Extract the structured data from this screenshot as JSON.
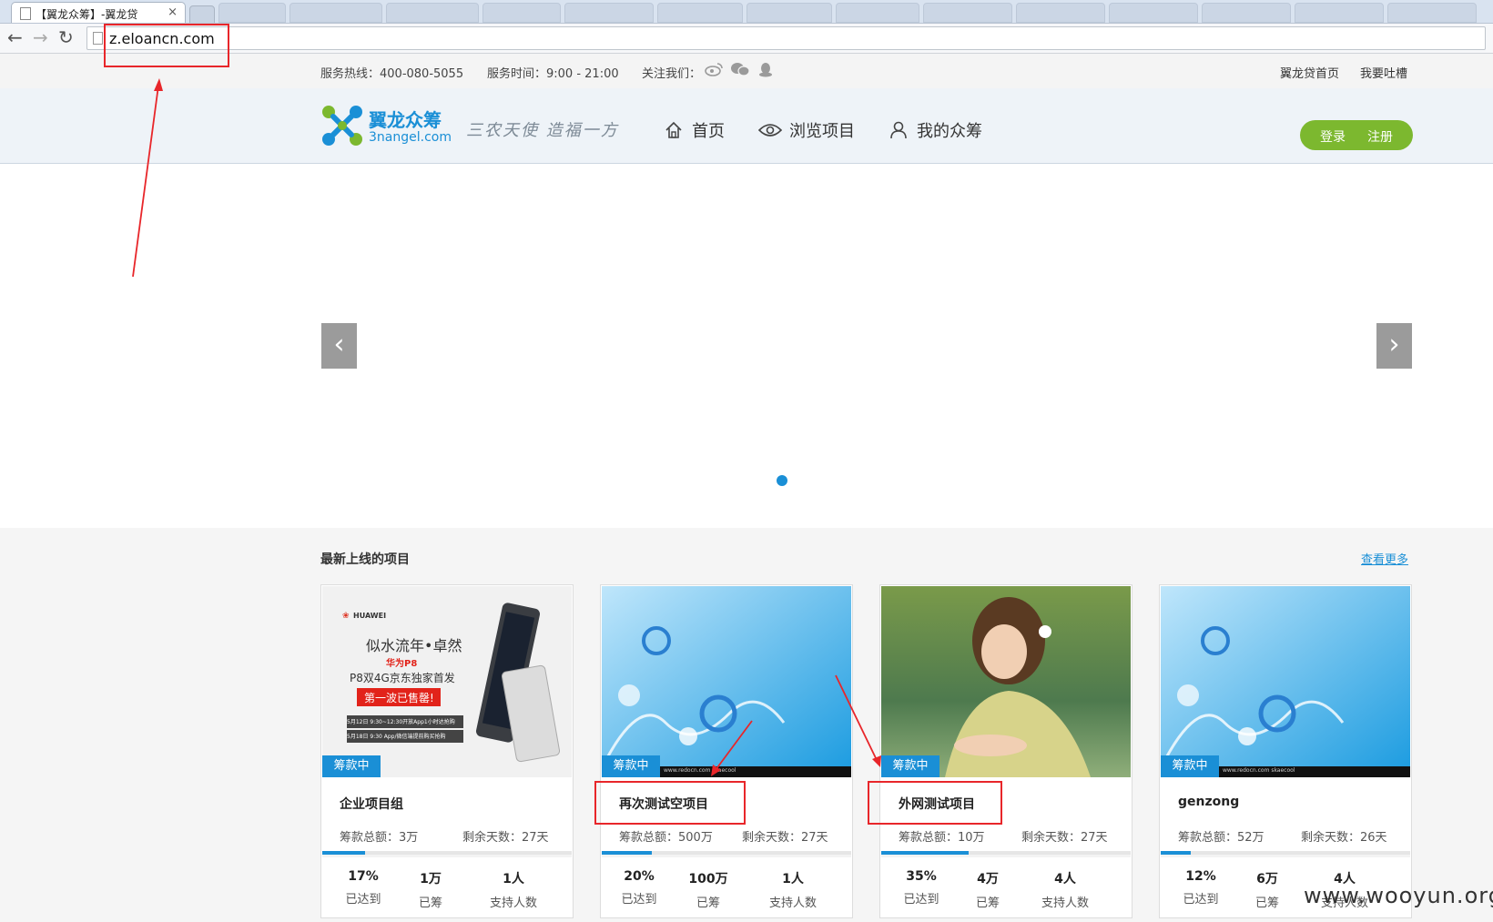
{
  "browser": {
    "tab_title": "【翼龙众筹】-翼龙贷",
    "tab_close": "×",
    "url": "z.eloancn.com"
  },
  "topbar": {
    "hotline": "服务热线：400-080-5055",
    "hours": "服务时间：9:00 - 21:00",
    "follow": "关注我们：",
    "home_link": "翼龙贷首页",
    "feedback_link": "我要吐槽"
  },
  "header": {
    "logo_cn": "翼龙众筹",
    "logo_en": "3nangel.com",
    "slogan": "三农天使  造福一方",
    "nav": [
      {
        "label": "首页",
        "icon": "home-icon"
      },
      {
        "label": "浏览项目",
        "icon": "eye-icon"
      },
      {
        "label": "我的众筹",
        "icon": "user-icon"
      }
    ],
    "login": "登录",
    "register": "注册"
  },
  "banner": {
    "prev": "‹",
    "next": "›"
  },
  "section": {
    "title": "最新上线的项目",
    "more": "查看更多",
    "projects": [
      {
        "name": "企业项目组",
        "badge": "筹款中",
        "total": "筹款总额：3万",
        "remain": "剩余天数：27天",
        "progress": 17,
        "percent": "17%",
        "percent_label": "已达到",
        "raised": "1万",
        "raised_label": "已筹",
        "backers": "1人",
        "backers_label": "支持人数",
        "image": "huawei-ad",
        "ad": {
          "brand": "HUAWEI",
          "title": "似水流年•卓然",
          "model": "华为P8",
          "sub": "P8双4G京东独家首发",
          "sold": "第一波已售罄!",
          "line1_tag": "5月12日",
          "line1": "9:30~12:30开放App1小时达抢购",
          "line2_tag": "5月18日",
          "line2": "9:30 App/微信端提前购买抢购"
        }
      },
      {
        "name": "再次测试空项目",
        "badge": "筹款中",
        "total": "筹款总额：500万",
        "remain": "剩余天数：27天",
        "progress": 20,
        "percent": "20%",
        "percent_label": "已达到",
        "raised": "100万",
        "raised_label": "已筹",
        "backers": "1人",
        "backers_label": "支持人数",
        "image": "blue-floral",
        "caption": "www.redocn.com  skaecool"
      },
      {
        "name": "外网测试项目",
        "badge": "筹款中",
        "total": "筹款总额：10万",
        "remain": "剩余天数：27天",
        "progress": 35,
        "percent": "35%",
        "percent_label": "已达到",
        "raised": "4万",
        "raised_label": "已筹",
        "backers": "4人",
        "backers_label": "支持人数",
        "image": "woman-photo"
      },
      {
        "name": "genzong",
        "badge": "筹款中",
        "total": "筹款总额：52万",
        "remain": "剩余天数：26天",
        "progress": 12,
        "percent": "12%",
        "percent_label": "已达到",
        "raised": "6万",
        "raised_label": "已筹",
        "backers": "4人",
        "backers_label": "支持人数",
        "image": "blue-floral",
        "caption": "www.redocn.com  skaecool"
      }
    ]
  },
  "watermark": "www.wooyun.org",
  "colors": {
    "accent": "#1a8fd6",
    "login_green": "#7cb82f",
    "annotation_red": "#e8262a"
  }
}
